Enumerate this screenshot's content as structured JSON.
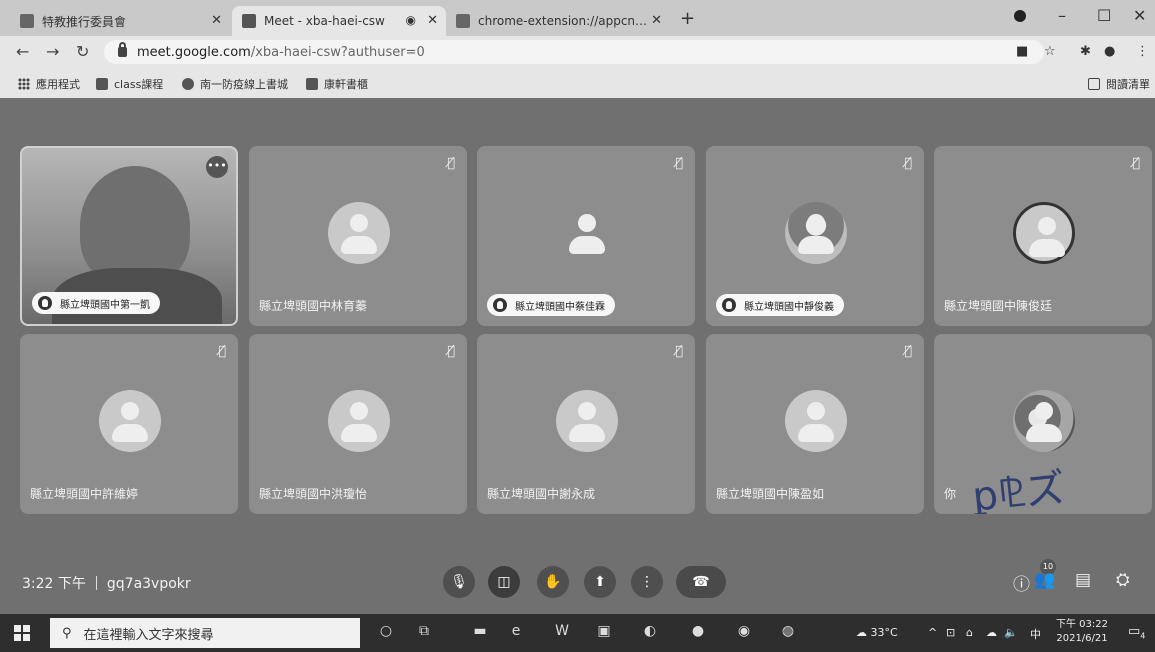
{
  "browser": {
    "tabs": [
      {
        "title": "特教推行委員會"
      },
      {
        "title": "Meet - xba-haei-csw"
      },
      {
        "title": "chrome-extension://appcnbie"
      }
    ],
    "url": {
      "host": "meet.google.com",
      "path": "/xba-haei-csw?authuser=0"
    },
    "bookmarks": [
      "應用程式",
      "class課程",
      "南一防疫線上書城",
      "康軒書櫃"
    ],
    "reading_list": "閱讀清單"
  },
  "meet": {
    "participants": [
      {
        "name": "縣立埤頭國中第一凱",
        "hand_raised": true,
        "camera": true
      },
      {
        "name": "縣立埤頭國中林育蓁",
        "hand_raised": false,
        "muted": true
      },
      {
        "name": "縣立埤頭國中蔡佳霖",
        "hand_raised": true,
        "muted": true
      },
      {
        "name": "縣立埤頭國中靜俊義",
        "hand_raised": true,
        "muted": true
      },
      {
        "name": "縣立埤頭國中陳俊廷",
        "hand_raised": false,
        "muted": true
      },
      {
        "name": "縣立埤頭國中許維婷",
        "hand_raised": false,
        "muted": true
      },
      {
        "name": "縣立埤頭國中洪瓊怡",
        "hand_raised": false,
        "muted": true
      },
      {
        "name": "縣立埤頭國中謝永成",
        "hand_raised": false,
        "muted": true
      },
      {
        "name": "縣立埤頭國中陳盈如",
        "hand_raised": false,
        "muted": true
      },
      {
        "name": "你",
        "hand_raised": false
      }
    ],
    "footer": {
      "time": "3:22 下午",
      "meeting_code": "gq7a3vpokr",
      "people_count": "10"
    }
  },
  "taskbar": {
    "search_placeholder": "在這裡輸入文字來搜尋",
    "weather": "33°C",
    "ime": "中",
    "time": "下午 03:22",
    "date": "2021/6/21",
    "notifications": "4"
  },
  "colors": {
    "background": "#707070",
    "tile": "#8d8d8d",
    "pill": "#f7f7f7"
  }
}
